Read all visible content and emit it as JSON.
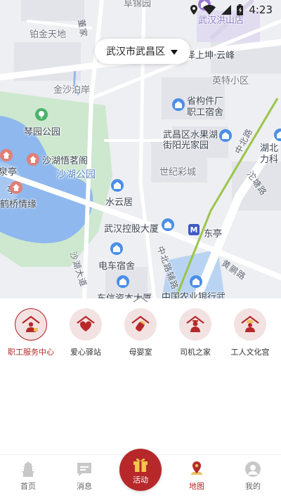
{
  "status_bar": {
    "time": "4:23"
  },
  "map": {
    "location_selector": {
      "label": "武汉市武昌区"
    },
    "labels": {
      "top_cut": "阜锦园",
      "area_top_right": "武汉洪山店",
      "tiezuan": "铂金天地",
      "dongjia": "董家",
      "zeshang": "泽上坤·云峰",
      "yingte": "英特小区",
      "jinsha": "金沙泊岸",
      "shenggoujian": "省构件厂",
      "zhigong": "职工宿舍",
      "qinyuan": "琴园公园",
      "shuiguohu": "武昌区水果湖",
      "jieyang": "街阳光家园",
      "hubei": "湖北",
      "dianli": "力科",
      "shahu_mingyuan": "沙湖悟茗阁",
      "shahu_park": "沙湖公园",
      "shijicaicheng": "世纪彩城",
      "zhongbei_road": "中北路",
      "tangjia_road": "沱塘路",
      "left_quan": "泉亭",
      "left_ting": "亭",
      "heqiao": "鹤桥情缘",
      "shuiyunju": "水云居",
      "wuhan_konggu": "武汉控股大厦",
      "dongting": "东亭",
      "zhongbei_fu": "中北路辅路",
      "shahu_road": "沙湖大道",
      "dianche": "电车宿舍",
      "huanghe_road": "黄鹂路",
      "nongye_bank": "中国农业银行武",
      "dongxin": "东信资本大厦"
    }
  },
  "services": [
    {
      "label": "职工服务中心",
      "icon": "worker-service-icon",
      "active": true
    },
    {
      "label": "爱心驿站",
      "icon": "heart-station-icon",
      "active": false
    },
    {
      "label": "母婴室",
      "icon": "mother-baby-icon",
      "active": false
    },
    {
      "label": "司机之家",
      "icon": "driver-home-icon",
      "active": false
    },
    {
      "label": "工人文化宫",
      "icon": "culture-palace-icon",
      "active": false
    }
  ],
  "tabs": [
    {
      "label": "首页",
      "icon": "home-icon"
    },
    {
      "label": "消息",
      "icon": "message-icon"
    },
    {
      "label": "活动",
      "icon": "gift-icon"
    },
    {
      "label": "地图",
      "icon": "map-pin-icon"
    },
    {
      "label": "我的",
      "icon": "profile-icon"
    }
  ],
  "colors": {
    "accent": "#b7282a",
    "service_bg": "#f3e2e2",
    "lake": "#8fb8ee",
    "park": "#cde8cf"
  }
}
